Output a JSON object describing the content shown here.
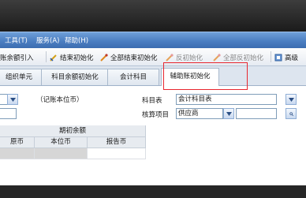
{
  "menubar": {
    "items": [
      {
        "label": "工具(T)"
      },
      {
        "label": "服务(A)"
      },
      {
        "label": "帮助(H)"
      }
    ]
  },
  "toolbar": {
    "items": [
      {
        "label": "账余额引入",
        "icon": "import-icon",
        "enabled": true
      },
      {
        "label": "结束初始化",
        "icon": "finish-init-icon",
        "enabled": true
      },
      {
        "label": "全部结束初始化",
        "icon": "finish-all-init-icon",
        "enabled": true
      },
      {
        "label": "反初始化",
        "icon": "reverse-init-icon",
        "enabled": false
      },
      {
        "label": "全部反初始化",
        "icon": "reverse-all-init-icon",
        "enabled": false
      },
      {
        "label": "高级",
        "icon": "advanced-icon",
        "enabled": true
      }
    ]
  },
  "tabs": [
    {
      "label": "组织单元",
      "active": false
    },
    {
      "label": "科目余额初始化",
      "active": false
    },
    {
      "label": "会计科目",
      "active": false
    },
    {
      "label": "辅助账初始化",
      "active": true
    }
  ],
  "form": {
    "currency_note": "（记账本位币）",
    "subject_table_label": "科目表",
    "subject_table_value": "会计科目表",
    "aux_item_label": "核算项目",
    "aux_item_value": "供应商"
  },
  "grid": {
    "group_header": "期初余额",
    "columns": [
      "原币",
      "本位币",
      "报告币"
    ]
  },
  "colors": {
    "menubar": "#4c7fc2",
    "highlight_border": "#e8262f"
  }
}
